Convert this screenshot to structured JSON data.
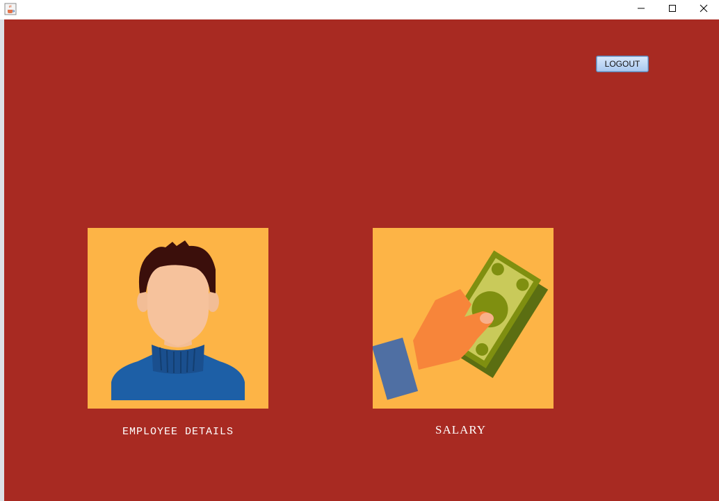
{
  "window": {
    "title": "",
    "icon": "java-cup-icon",
    "controls": [
      "minimize-icon",
      "maximize-icon",
      "close-icon"
    ]
  },
  "theme": {
    "background": "#a82a22",
    "tile": "#fdb446"
  },
  "header": {
    "logout_label": "LOGOUT"
  },
  "tiles": [
    {
      "icon": "employee-avatar-icon",
      "label": "EMPLOYEE DETAILS"
    },
    {
      "icon": "hand-money-icon",
      "label": "SALARY"
    }
  ]
}
